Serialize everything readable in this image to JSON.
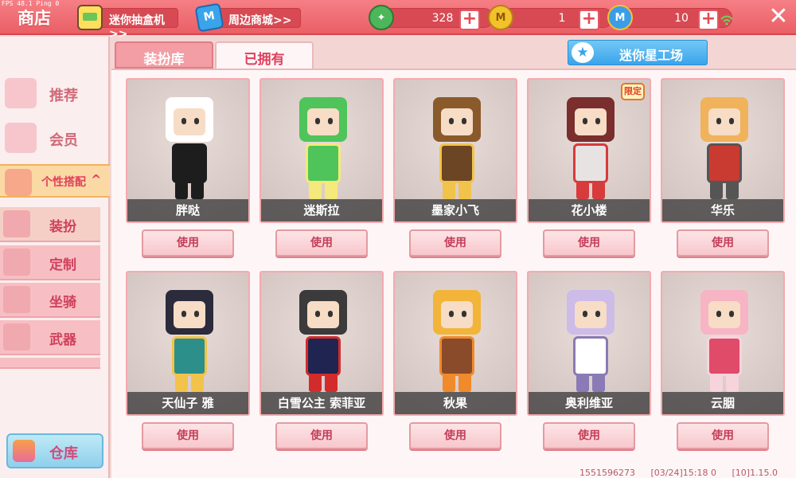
{
  "status": {
    "fps": "FPS 48.1  Ping 0"
  },
  "header": {
    "title": "商店",
    "gacha_link": "迷你抽盒机>>",
    "mall_link": "周边商城>>",
    "mall_icon_text": "M",
    "currencies": [
      {
        "name": "green-gem",
        "value": "328",
        "color": "#4db55a",
        "symbol": "✦"
      },
      {
        "name": "gold-coin",
        "value": "1",
        "color": "#f3c12a",
        "symbol": "M"
      },
      {
        "name": "blue-coin",
        "value": "10",
        "color": "#3a9de8",
        "symbol": "M"
      }
    ],
    "plus_symbol": "+",
    "close_symbol": "✕"
  },
  "sidebar": {
    "items": [
      {
        "label": "推荐"
      },
      {
        "label": "会员"
      },
      {
        "label": "个性搭配",
        "expanded": true
      }
    ],
    "sub_items": [
      {
        "label": "装扮",
        "selected": true
      },
      {
        "label": "定制"
      },
      {
        "label": "坐骑"
      },
      {
        "label": "武器"
      }
    ],
    "chevron": "^",
    "warehouse": "仓库"
  },
  "tabs": [
    {
      "label": "装扮库",
      "active": false
    },
    {
      "label": "已拥有",
      "active": true
    }
  ],
  "star_workshop": {
    "label": "迷你星工场",
    "icon": "★"
  },
  "use_label": "使用",
  "limited_badge": "限定",
  "outfits": [
    {
      "name": "胖哒",
      "hair": "#ffffff",
      "cloth": "#1d1d1d",
      "accent": "#1d1d1d"
    },
    {
      "name": "迷斯拉",
      "hair": "#4fc45a",
      "cloth": "#4fc45a",
      "accent": "#f4e97a"
    },
    {
      "name": "墨家小飞",
      "hair": "#8a5a2b",
      "cloth": "#6b4524",
      "accent": "#f2c34a"
    },
    {
      "name": "花小楼",
      "hair": "#7a2e2e",
      "cloth": "#e8e3e3",
      "accent": "#d73b3b",
      "badge": true
    },
    {
      "name": "华乐",
      "hair": "#f0b25a",
      "cloth": "#c93b30",
      "accent": "#555555"
    },
    {
      "name": "天仙子 雅",
      "hair": "#2b2b3b",
      "cloth": "#2c8f8a",
      "accent": "#f2c34a"
    },
    {
      "name": "白雪公主 索菲亚",
      "hair": "#3b3b3b",
      "cloth": "#1f2450",
      "accent": "#d32b2b"
    },
    {
      "name": "秋果",
      "hair": "#f2b53a",
      "cloth": "#8a4b2a",
      "accent": "#f08a2a"
    },
    {
      "name": "奥利维亚",
      "hair": "#cdbbe8",
      "cloth": "#ffffff",
      "accent": "#8a7ab5"
    },
    {
      "name": "云胭",
      "hair": "#f7b4c4",
      "cloth": "#e04b6a",
      "accent": "#f7d4dc"
    }
  ],
  "footer": {
    "uid": "1551596273",
    "time": "[03/24]15:18 0",
    "version": "[10]1.15.0"
  }
}
